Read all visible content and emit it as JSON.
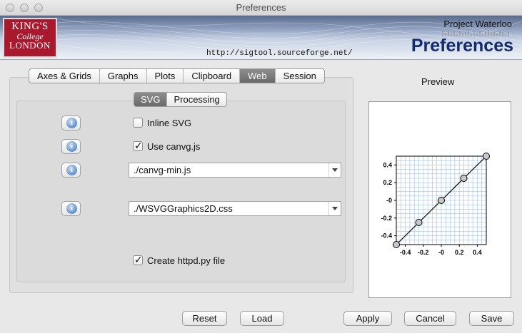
{
  "window": {
    "title": "Preferences"
  },
  "banner": {
    "logo_line1": "KING'S",
    "logo_line2": "College",
    "logo_line3": "LONDON",
    "url": "http://sigtool.sourceforge.net/",
    "project": "Project Waterloo",
    "heading": "Preferences"
  },
  "tabs": [
    {
      "label": "Axes & Grids",
      "active": false
    },
    {
      "label": "Graphs",
      "active": false
    },
    {
      "label": "Plots",
      "active": false
    },
    {
      "label": "Clipboard",
      "active": false
    },
    {
      "label": "Web",
      "active": true
    },
    {
      "label": "Session",
      "active": false
    }
  ],
  "subtabs": [
    {
      "label": "SVG",
      "active": true
    },
    {
      "label": "Processing",
      "active": false
    }
  ],
  "options": {
    "inline_svg": {
      "label": "Inline SVG",
      "checked": false
    },
    "use_canvg": {
      "label": "Use canvg.js",
      "checked": true
    },
    "canvg_path": {
      "value": "./canvg-min.js"
    },
    "css_path": {
      "value": "./WSVGGraphics2D.css"
    },
    "create_httpd": {
      "label": "Create httpd.py file",
      "checked": true
    }
  },
  "info_icon_glyph": "i",
  "preview": {
    "label": "Preview",
    "chart_data": {
      "type": "line",
      "x": [
        -0.5,
        -0.25,
        0,
        0.25,
        0.5
      ],
      "y": [
        -0.5,
        -0.25,
        0,
        0.25,
        0.5
      ],
      "xlim": [
        -0.5,
        0.5
      ],
      "ylim": [
        -0.5,
        0.5
      ],
      "xticks": [
        "-0.4",
        "-0.2",
        "-0",
        "0.2",
        "0.4"
      ],
      "yticks": [
        "0.4",
        "0.2",
        "-0",
        "-0.2",
        "-0.4"
      ],
      "grid": true,
      "grid_color": "#9cc0e6",
      "marker": "circle",
      "marker_color": "#c8c8c8"
    }
  },
  "buttons": {
    "reset": "Reset",
    "load": "Load",
    "apply": "Apply",
    "cancel": "Cancel",
    "save": "Save"
  }
}
